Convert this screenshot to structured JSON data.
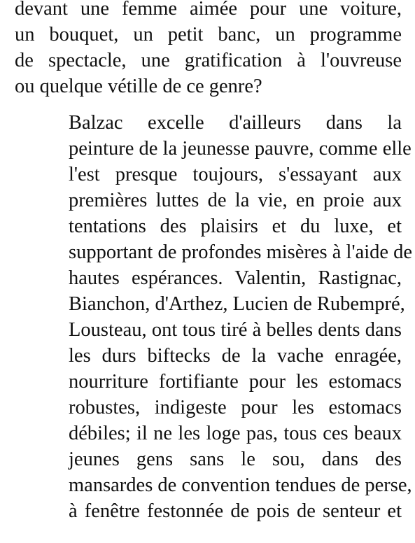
{
  "paragraphs": [
    {
      "lines": [
        "devant une femme aimée pour une voiture,",
        "un bouquet, un petit banc, un programme",
        "de spectacle, une gratification à l'ouvreuse",
        "ou quelque vétille de ce genre?"
      ]
    },
    {
      "lines": [
        "Balzac excelle d'ailleurs dans la",
        "peinture de la jeunesse pauvre, comme elle",
        "l'est presque toujours, s'essayant aux",
        "premières luttes de la vie, en proie aux",
        "tentations des plaisirs et du luxe, et",
        "supportant de profondes misères à l'aide de",
        "hautes espérances. Valentin, Rastignac,",
        "Bianchon, d'Arthez, Lucien de Rubempré,",
        "Lousteau, ont tous tiré à belles dents dans",
        "les durs biftecks de la vache enragée,",
        "nourriture fortifiante pour les estomacs",
        "robustes, indigeste pour les estomacs",
        "débiles; il ne les loge pas, tous ces beaux",
        "jeunes gens sans le sou, dans des",
        "mansardes de convention tendues de perse,",
        "à fenêtre festonnée de pois de senteur et"
      ]
    }
  ]
}
